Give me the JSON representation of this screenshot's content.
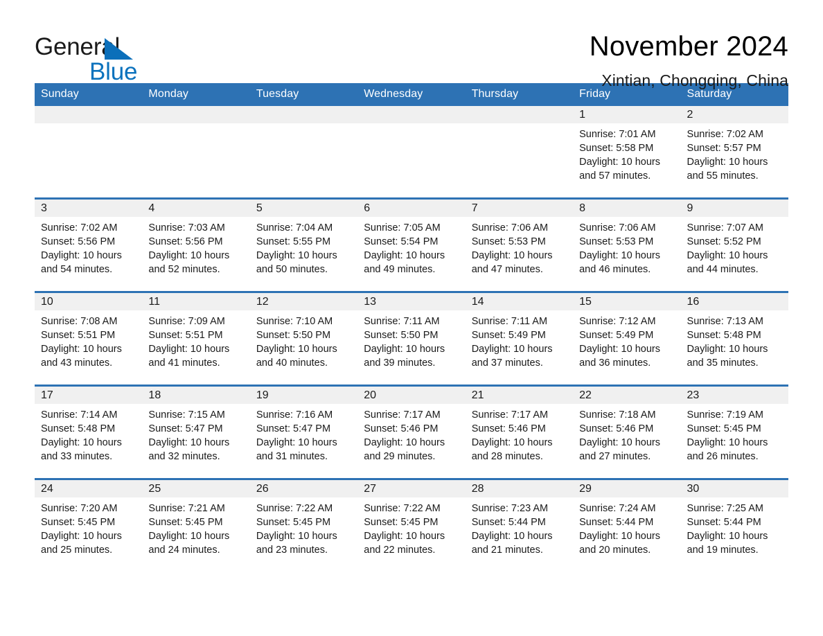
{
  "brand": {
    "name_dark": "General",
    "name_blue": "Blue",
    "triangle_color": "#0b6fba",
    "blue_color": "#0b72bd"
  },
  "header": {
    "title": "November 2024",
    "subtitle": "Xintian, Chongqing, China"
  },
  "theme": {
    "header_blue": "#2d72b4",
    "daynum_band": "#f0f0f0",
    "cell_bg": "#ffffff",
    "text": "#1a1a1a"
  },
  "weekday_headers": [
    "Sunday",
    "Monday",
    "Tuesday",
    "Wednesday",
    "Thursday",
    "Friday",
    "Saturday"
  ],
  "weeks": [
    [
      {
        "day": "",
        "sunrise": "",
        "sunset": "",
        "daylight1": "",
        "daylight2": ""
      },
      {
        "day": "",
        "sunrise": "",
        "sunset": "",
        "daylight1": "",
        "daylight2": ""
      },
      {
        "day": "",
        "sunrise": "",
        "sunset": "",
        "daylight1": "",
        "daylight2": ""
      },
      {
        "day": "",
        "sunrise": "",
        "sunset": "",
        "daylight1": "",
        "daylight2": ""
      },
      {
        "day": "",
        "sunrise": "",
        "sunset": "",
        "daylight1": "",
        "daylight2": ""
      },
      {
        "day": "1",
        "sunrise": "Sunrise: 7:01 AM",
        "sunset": "Sunset: 5:58 PM",
        "daylight1": "Daylight: 10 hours",
        "daylight2": "and 57 minutes."
      },
      {
        "day": "2",
        "sunrise": "Sunrise: 7:02 AM",
        "sunset": "Sunset: 5:57 PM",
        "daylight1": "Daylight: 10 hours",
        "daylight2": "and 55 minutes."
      }
    ],
    [
      {
        "day": "3",
        "sunrise": "Sunrise: 7:02 AM",
        "sunset": "Sunset: 5:56 PM",
        "daylight1": "Daylight: 10 hours",
        "daylight2": "and 54 minutes."
      },
      {
        "day": "4",
        "sunrise": "Sunrise: 7:03 AM",
        "sunset": "Sunset: 5:56 PM",
        "daylight1": "Daylight: 10 hours",
        "daylight2": "and 52 minutes."
      },
      {
        "day": "5",
        "sunrise": "Sunrise: 7:04 AM",
        "sunset": "Sunset: 5:55 PM",
        "daylight1": "Daylight: 10 hours",
        "daylight2": "and 50 minutes."
      },
      {
        "day": "6",
        "sunrise": "Sunrise: 7:05 AM",
        "sunset": "Sunset: 5:54 PM",
        "daylight1": "Daylight: 10 hours",
        "daylight2": "and 49 minutes."
      },
      {
        "day": "7",
        "sunrise": "Sunrise: 7:06 AM",
        "sunset": "Sunset: 5:53 PM",
        "daylight1": "Daylight: 10 hours",
        "daylight2": "and 47 minutes."
      },
      {
        "day": "8",
        "sunrise": "Sunrise: 7:06 AM",
        "sunset": "Sunset: 5:53 PM",
        "daylight1": "Daylight: 10 hours",
        "daylight2": "and 46 minutes."
      },
      {
        "day": "9",
        "sunrise": "Sunrise: 7:07 AM",
        "sunset": "Sunset: 5:52 PM",
        "daylight1": "Daylight: 10 hours",
        "daylight2": "and 44 minutes."
      }
    ],
    [
      {
        "day": "10",
        "sunrise": "Sunrise: 7:08 AM",
        "sunset": "Sunset: 5:51 PM",
        "daylight1": "Daylight: 10 hours",
        "daylight2": "and 43 minutes."
      },
      {
        "day": "11",
        "sunrise": "Sunrise: 7:09 AM",
        "sunset": "Sunset: 5:51 PM",
        "daylight1": "Daylight: 10 hours",
        "daylight2": "and 41 minutes."
      },
      {
        "day": "12",
        "sunrise": "Sunrise: 7:10 AM",
        "sunset": "Sunset: 5:50 PM",
        "daylight1": "Daylight: 10 hours",
        "daylight2": "and 40 minutes."
      },
      {
        "day": "13",
        "sunrise": "Sunrise: 7:11 AM",
        "sunset": "Sunset: 5:50 PM",
        "daylight1": "Daylight: 10 hours",
        "daylight2": "and 39 minutes."
      },
      {
        "day": "14",
        "sunrise": "Sunrise: 7:11 AM",
        "sunset": "Sunset: 5:49 PM",
        "daylight1": "Daylight: 10 hours",
        "daylight2": "and 37 minutes."
      },
      {
        "day": "15",
        "sunrise": "Sunrise: 7:12 AM",
        "sunset": "Sunset: 5:49 PM",
        "daylight1": "Daylight: 10 hours",
        "daylight2": "and 36 minutes."
      },
      {
        "day": "16",
        "sunrise": "Sunrise: 7:13 AM",
        "sunset": "Sunset: 5:48 PM",
        "daylight1": "Daylight: 10 hours",
        "daylight2": "and 35 minutes."
      }
    ],
    [
      {
        "day": "17",
        "sunrise": "Sunrise: 7:14 AM",
        "sunset": "Sunset: 5:48 PM",
        "daylight1": "Daylight: 10 hours",
        "daylight2": "and 33 minutes."
      },
      {
        "day": "18",
        "sunrise": "Sunrise: 7:15 AM",
        "sunset": "Sunset: 5:47 PM",
        "daylight1": "Daylight: 10 hours",
        "daylight2": "and 32 minutes."
      },
      {
        "day": "19",
        "sunrise": "Sunrise: 7:16 AM",
        "sunset": "Sunset: 5:47 PM",
        "daylight1": "Daylight: 10 hours",
        "daylight2": "and 31 minutes."
      },
      {
        "day": "20",
        "sunrise": "Sunrise: 7:17 AM",
        "sunset": "Sunset: 5:46 PM",
        "daylight1": "Daylight: 10 hours",
        "daylight2": "and 29 minutes."
      },
      {
        "day": "21",
        "sunrise": "Sunrise: 7:17 AM",
        "sunset": "Sunset: 5:46 PM",
        "daylight1": "Daylight: 10 hours",
        "daylight2": "and 28 minutes."
      },
      {
        "day": "22",
        "sunrise": "Sunrise: 7:18 AM",
        "sunset": "Sunset: 5:46 PM",
        "daylight1": "Daylight: 10 hours",
        "daylight2": "and 27 minutes."
      },
      {
        "day": "23",
        "sunrise": "Sunrise: 7:19 AM",
        "sunset": "Sunset: 5:45 PM",
        "daylight1": "Daylight: 10 hours",
        "daylight2": "and 26 minutes."
      }
    ],
    [
      {
        "day": "24",
        "sunrise": "Sunrise: 7:20 AM",
        "sunset": "Sunset: 5:45 PM",
        "daylight1": "Daylight: 10 hours",
        "daylight2": "and 25 minutes."
      },
      {
        "day": "25",
        "sunrise": "Sunrise: 7:21 AM",
        "sunset": "Sunset: 5:45 PM",
        "daylight1": "Daylight: 10 hours",
        "daylight2": "and 24 minutes."
      },
      {
        "day": "26",
        "sunrise": "Sunrise: 7:22 AM",
        "sunset": "Sunset: 5:45 PM",
        "daylight1": "Daylight: 10 hours",
        "daylight2": "and 23 minutes."
      },
      {
        "day": "27",
        "sunrise": "Sunrise: 7:22 AM",
        "sunset": "Sunset: 5:45 PM",
        "daylight1": "Daylight: 10 hours",
        "daylight2": "and 22 minutes."
      },
      {
        "day": "28",
        "sunrise": "Sunrise: 7:23 AM",
        "sunset": "Sunset: 5:44 PM",
        "daylight1": "Daylight: 10 hours",
        "daylight2": "and 21 minutes."
      },
      {
        "day": "29",
        "sunrise": "Sunrise: 7:24 AM",
        "sunset": "Sunset: 5:44 PM",
        "daylight1": "Daylight: 10 hours",
        "daylight2": "and 20 minutes."
      },
      {
        "day": "30",
        "sunrise": "Sunrise: 7:25 AM",
        "sunset": "Sunset: 5:44 PM",
        "daylight1": "Daylight: 10 hours",
        "daylight2": "and 19 minutes."
      }
    ]
  ]
}
